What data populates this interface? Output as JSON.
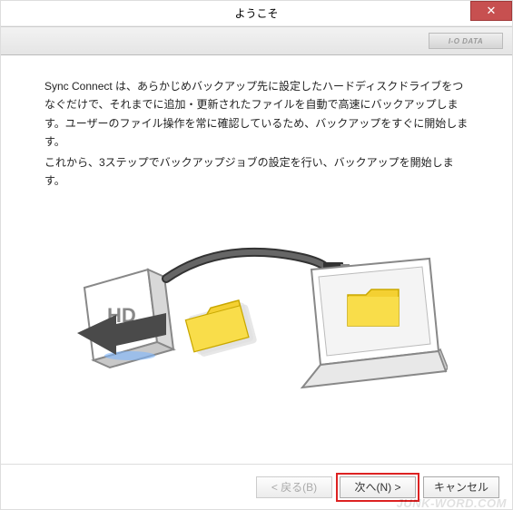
{
  "window": {
    "title": "ようこそ",
    "brand": "I-O DATA"
  },
  "body": {
    "para1": "Sync Connect は、あらかじめバックアップ先に設定したハードディスクドライブをつなぐだけで、それまでに追加・更新されたファイルを自動で高速にバックアップします。ユーザーのファイル操作を常に確認しているため、バックアップをすぐに開始します。",
    "para2": "これから、3ステップでバックアップジョブの設定を行い、バックアップを開始します。"
  },
  "illustration": {
    "hd_label": "HD"
  },
  "buttons": {
    "back": "< 戻る(B)",
    "next": "次へ(N) >",
    "cancel": "キャンセル"
  },
  "watermark": "JUNK-WORD.COM"
}
